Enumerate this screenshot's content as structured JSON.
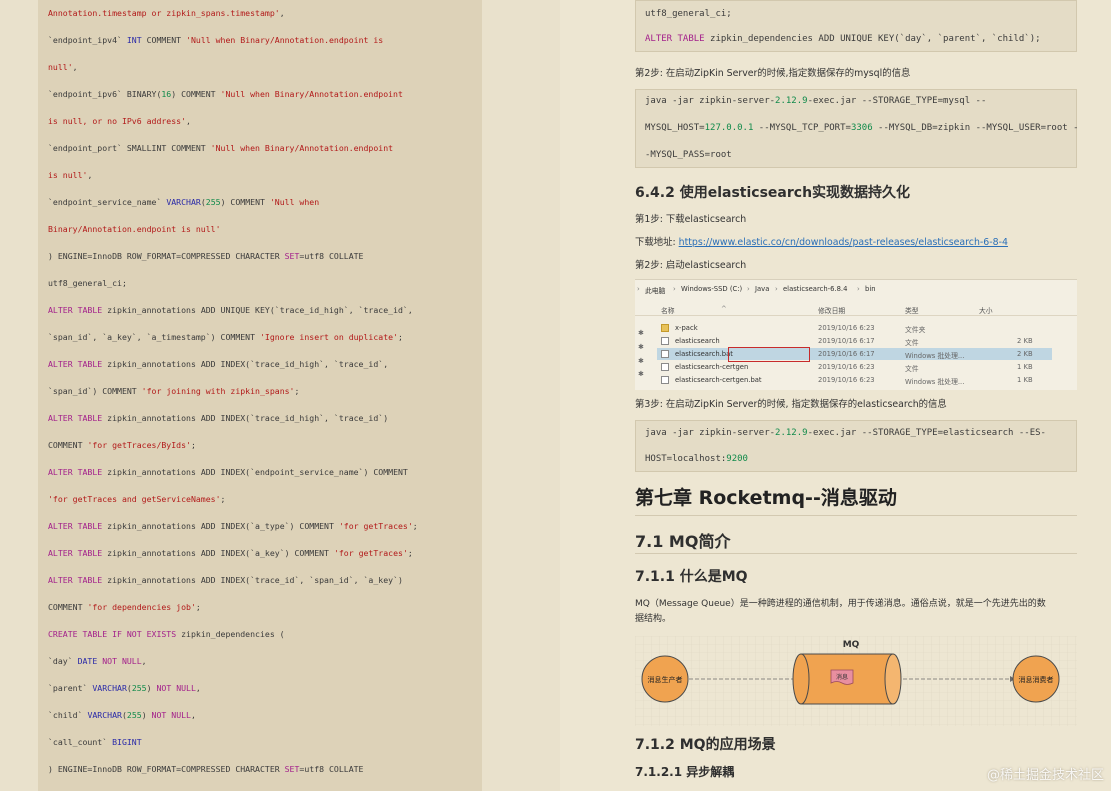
{
  "left_code": [
    [
      [
        "st",
        "Annotation.timestamp or zipkin_spans.timestamp'"
      ],
      [
        "pl",
        ","
      ]
    ],
    [
      [
        "pl",
        "`endpoint_ipv4` "
      ],
      [
        "ty",
        "INT"
      ],
      [
        "pl",
        " COMMENT "
      ],
      [
        "st",
        "'Null when Binary/Annotation.endpoint is"
      ]
    ],
    [
      [
        "st",
        "null'"
      ],
      [
        "pl",
        ","
      ]
    ],
    [
      [
        "pl",
        "`endpoint_ipv6` BINARY("
      ],
      [
        "nm",
        "16"
      ],
      [
        "pl",
        ") COMMENT "
      ],
      [
        "st",
        "'Null when Binary/Annotation.endpoint"
      ]
    ],
    [
      [
        "st",
        "is null, or no IPv6 address'"
      ],
      [
        "pl",
        ","
      ]
    ],
    [
      [
        "pl",
        "`endpoint_port` SMALLINT COMMENT "
      ],
      [
        "st",
        "'Null when Binary/Annotation.endpoint"
      ]
    ],
    [
      [
        "st",
        "is null'"
      ],
      [
        "pl",
        ","
      ]
    ],
    [
      [
        "pl",
        "`endpoint_service_name` "
      ],
      [
        "ty",
        "VARCHAR"
      ],
      [
        "pl",
        "("
      ],
      [
        "nm",
        "255"
      ],
      [
        "pl",
        ") COMMENT "
      ],
      [
        "st",
        "'Null when"
      ]
    ],
    [
      [
        "st",
        "Binary/Annotation.endpoint is null'"
      ]
    ],
    [
      [
        "pl",
        ") ENGINE=InnoDB ROW_FORMAT=COMPRESSED CHARACTER "
      ],
      [
        "kw",
        "SET"
      ],
      [
        "pl",
        "=utf8 COLLATE"
      ]
    ],
    [
      [
        "pl",
        "utf8_general_ci;"
      ]
    ],
    [
      [
        "kw",
        "ALTER TABLE"
      ],
      [
        "pl",
        " zipkin_annotations ADD UNIQUE KEY(`trace_id_high`, `trace_id`,"
      ]
    ],
    [
      [
        "pl",
        "`span_id`, `a_key`, `a_timestamp`) COMMENT "
      ],
      [
        "st",
        "'Ignore insert on duplicate'"
      ],
      [
        "pl",
        ";"
      ]
    ],
    [
      [
        "kw",
        "ALTER TABLE"
      ],
      [
        "pl",
        " zipkin_annotations ADD INDEX(`trace_id_high`, `trace_id`,"
      ]
    ],
    [
      [
        "pl",
        "`span_id`) COMMENT "
      ],
      [
        "st",
        "'for joining with zipkin_spans'"
      ],
      [
        "pl",
        ";"
      ]
    ],
    [
      [
        "kw",
        "ALTER TABLE"
      ],
      [
        "pl",
        " zipkin_annotations ADD INDEX(`trace_id_high`, `trace_id`)"
      ]
    ],
    [
      [
        "pl",
        "COMMENT "
      ],
      [
        "st",
        "'for getTraces/ByIds'"
      ],
      [
        "pl",
        ";"
      ]
    ],
    [
      [
        "kw",
        "ALTER TABLE"
      ],
      [
        "pl",
        " zipkin_annotations ADD INDEX(`endpoint_service_name`) COMMENT"
      ]
    ],
    [
      [
        "st",
        "'for getTraces and getServiceNames'"
      ],
      [
        "pl",
        ";"
      ]
    ],
    [
      [
        "kw",
        "ALTER TABLE"
      ],
      [
        "pl",
        " zipkin_annotations ADD INDEX(`a_type`) COMMENT "
      ],
      [
        "st",
        "'for getTraces'"
      ],
      [
        "pl",
        ";"
      ]
    ],
    [
      [
        "kw",
        "ALTER TABLE"
      ],
      [
        "pl",
        " zipkin_annotations ADD INDEX(`a_key`) COMMENT "
      ],
      [
        "st",
        "'for getTraces'"
      ],
      [
        "pl",
        ";"
      ]
    ],
    [
      [
        "kw",
        "ALTER TABLE"
      ],
      [
        "pl",
        " zipkin_annotations ADD INDEX(`trace_id`, `span_id`, `a_key`)"
      ]
    ],
    [
      [
        "pl",
        "COMMENT "
      ],
      [
        "st",
        "'for dependencies job'"
      ],
      [
        "pl",
        ";"
      ]
    ],
    [
      [
        "kw",
        "CREATE TABLE IF NOT EXISTS"
      ],
      [
        "pl",
        " zipkin_dependencies ("
      ]
    ],
    [
      [
        "pl",
        "`day` "
      ],
      [
        "ty",
        "DATE"
      ],
      [
        "pl",
        " "
      ],
      [
        "kw",
        "NOT NULL"
      ],
      [
        "pl",
        ","
      ]
    ],
    [
      [
        "pl",
        "`parent` "
      ],
      [
        "ty",
        "VARCHAR"
      ],
      [
        "pl",
        "("
      ],
      [
        "nm",
        "255"
      ],
      [
        "pl",
        ") "
      ],
      [
        "kw",
        "NOT NULL"
      ],
      [
        "pl",
        ","
      ]
    ],
    [
      [
        "pl",
        "`child` "
      ],
      [
        "ty",
        "VARCHAR"
      ],
      [
        "pl",
        "("
      ],
      [
        "nm",
        "255"
      ],
      [
        "pl",
        ") "
      ],
      [
        "kw",
        "NOT NULL"
      ],
      [
        "pl",
        ","
      ]
    ],
    [
      [
        "pl",
        "`call_count` "
      ],
      [
        "ty",
        "BIGINT"
      ]
    ],
    [
      [
        "pl",
        ") ENGINE=InnoDB ROW_FORMAT=COMPRESSED CHARACTER "
      ],
      [
        "kw",
        "SET"
      ],
      [
        "pl",
        "=utf8 COLLATE"
      ]
    ]
  ],
  "right": {
    "top_code": {
      "line1": "utf8_general_ci;",
      "line2_kw": "ALTER TABLE",
      "line2_rest": " zipkin_dependencies ADD UNIQUE KEY(`day`, `parent`, `child`);"
    },
    "step2_mysql": "第2步: 在启动ZipKin Server的时候,指定数据保存的mysql的信息",
    "mysql_cmd": {
      "l1_a": "java -jar zipkin-server-",
      "l1_num": "2.12.9",
      "l1_b": "-exec.jar --STORAGE_TYPE=mysql --",
      "l2_a": "MYSQL_HOST=",
      "l2_ip": "127.0.0.1",
      "l2_b": " --MYSQL_TCP_PORT=",
      "l2_port": "3306",
      "l2_c": " --MYSQL_DB=zipkin --MYSQL_USER=root -",
      "l3": "-MYSQL_PASS=root"
    },
    "heading_642": "6.4.2 使用elasticsearch实现数据持久化",
    "step1_es": "第1步: 下载elasticsearch",
    "download_label": "下载地址: ",
    "download_url": "https://www.elastic.co/cn/downloads/past-releases/elasticsearch-6-8-4",
    "step2_es": "第2步: 启动elasticsearch",
    "explorer": {
      "breadcrumb": [
        "此电脑",
        "Windows-SSD (C:)",
        "Java",
        "elasticsearch-6.8.4",
        "bin"
      ],
      "columns": {
        "name": "名称",
        "date": "修改日期",
        "type": "类型",
        "size": "大小"
      },
      "files": [
        {
          "name": "x-pack",
          "date": "2019/10/16 6:23",
          "type": "文件夹",
          "size": "",
          "icon": "folder-icon"
        },
        {
          "name": "elasticsearch",
          "date": "2019/10/16 6:17",
          "type": "文件",
          "size": "2 KB",
          "icon": "file-icon"
        },
        {
          "name": "elasticsearch.bat",
          "date": "2019/10/16 6:17",
          "type": "Windows 批处理...",
          "size": "2 KB",
          "icon": "batch-file-icon"
        },
        {
          "name": "elasticsearch-certgen",
          "date": "2019/10/16 6:23",
          "type": "文件",
          "size": "1 KB",
          "icon": "file-icon"
        },
        {
          "name": "elasticsearch-certgen.bat",
          "date": "2019/10/16 6:23",
          "type": "Windows 批处理...",
          "size": "1 KB",
          "icon": "batch-file-icon"
        }
      ],
      "selected_index": 2
    },
    "step3_es": "第3步: 在启动ZipKin Server的时候, 指定数据保存的elasticsearch的信息",
    "es_cmd": {
      "l1_a": "java -jar zipkin-server-",
      "l1_num": "2.12.9",
      "l1_b": "-exec.jar --STORAGE_TYPE=elasticsearch --ES-",
      "l2_a": "HOST=localhost:",
      "l2_port": "9200"
    },
    "chapter_title": "第七章 Rocketmq--消息驱动",
    "heading_71": "7.1 MQ简介",
    "heading_711": "7.1.1 什么是MQ",
    "mq_desc_l1": "MQ（Message Queue）是一种跨进程的通信机制，用于传递消息。通俗点说，就是一个先进先出的数",
    "mq_desc_l2": "据结构。",
    "diagram": {
      "title": "MQ",
      "producer": "消息生产者",
      "message": "消息",
      "consumer": "消息消费者"
    },
    "heading_712": "7.1.2 MQ的应用场景",
    "heading_7121": "7.1.2.1 异步解耦"
  },
  "watermark": "@稀土掘金技术社区",
  "colors": {
    "keyword": "#a3208b",
    "type": "#2a2aa8",
    "string": "#b21a1a",
    "number": "#108a4a",
    "link": "#2a6fb8",
    "diagram_orange": "#f0a350"
  }
}
